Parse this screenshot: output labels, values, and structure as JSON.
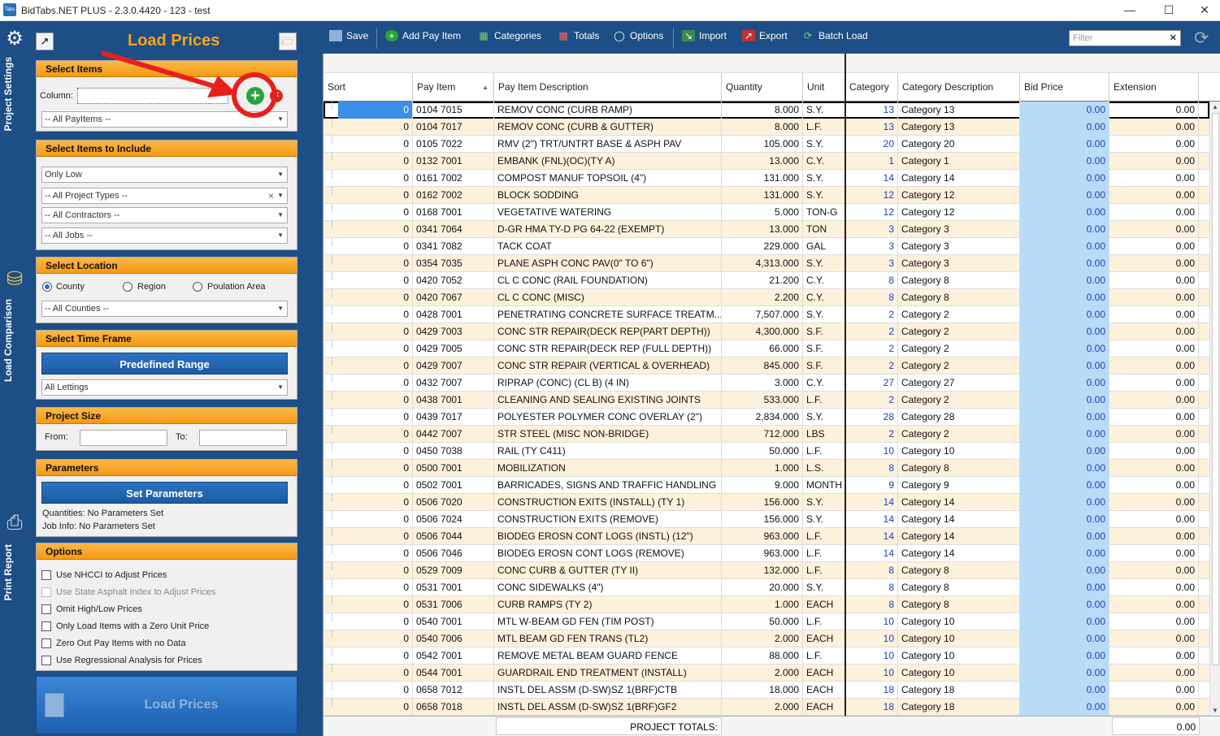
{
  "window": {
    "title": "BidTabs.NET PLUS - 2.3.0.4420 - 123 - test",
    "icon_text": "Tabs"
  },
  "vtabs": [
    {
      "label": "Project Settings",
      "icon": "gear-icon"
    },
    {
      "label": "Load Comparison",
      "icon": "database-icon"
    },
    {
      "label": "Print Report",
      "icon": "printer-icon"
    }
  ],
  "left": {
    "title": "Load Prices",
    "select_items": {
      "header": "Select Items",
      "column_label": "Column:",
      "payitems": "-- All PayItems --"
    },
    "include": {
      "header": "Select Items to Include",
      "price_mode": "Only Low",
      "project_types": "-- All Project Types --",
      "contractors": "-- All Contractors --",
      "jobs": "-- All Jobs --"
    },
    "location": {
      "header": "Select Location",
      "county": "County",
      "region": "Region",
      "population": "Poulation Area",
      "counties": "-- All Counties --"
    },
    "timeframe": {
      "header": "Select Time Frame",
      "button": "Predefined Range",
      "lettings": "All Lettings"
    },
    "size": {
      "header": "Project Size",
      "from": "From:",
      "to": "To:"
    },
    "params": {
      "header": "Parameters",
      "button": "Set Parameters",
      "qty": "Quantities: No Parameters Set",
      "job": "Job Info: No Parameters Set"
    },
    "options": {
      "header": "Options",
      "items": [
        "Use NHCCI to Adjust Prices",
        "Use State Asphalt Index to Adjust Prices",
        "Omit High/Low Prices",
        "Only Load Items with a Zero Unit  Price",
        "Zero Out Pay Items with no Data",
        "Use Regressional Analysis for Prices"
      ]
    },
    "load_button": "Load Prices"
  },
  "toolbar": {
    "save": "Save",
    "add": "Add Pay Item",
    "categories": "Categories",
    "totals": "Totals",
    "options": "Options",
    "import": "Import",
    "export": "Export",
    "batch": "Batch Load",
    "filter_placeholder": "Filter"
  },
  "grid": {
    "columns": [
      "Sort",
      "Pay Item",
      "Pay Item Description",
      "Quantity",
      "Unit",
      "Category",
      "Category Description",
      "Bid Price",
      "Extension"
    ],
    "rows": [
      [
        "0",
        "0104 7015",
        "REMOV CONC (CURB RAMP)",
        "8.000",
        "S.Y.",
        "13",
        "Category 13",
        "0.00",
        "0.00"
      ],
      [
        "0",
        "0104 7017",
        "REMOV CONC (CURB & GUTTER)",
        "8.000",
        "L.F.",
        "13",
        "Category 13",
        "0.00",
        "0.00"
      ],
      [
        "0",
        "0105 7022",
        "RMV (2\") TRT/UNTRT BASE & ASPH PAV",
        "105.000",
        "S.Y.",
        "20",
        "Category 20",
        "0.00",
        "0.00"
      ],
      [
        "0",
        "0132 7001",
        "EMBANK (FNL)(OC)(TY A)",
        "13.000",
        "C.Y.",
        "1",
        "Category 1",
        "0.00",
        "0.00"
      ],
      [
        "0",
        "0161 7002",
        "COMPOST MANUF TOPSOIL (4\")",
        "131.000",
        "S.Y.",
        "14",
        "Category 14",
        "0.00",
        "0.00"
      ],
      [
        "0",
        "0162 7002",
        "BLOCK SODDING",
        "131.000",
        "S.Y.",
        "12",
        "Category 12",
        "0.00",
        "0.00"
      ],
      [
        "0",
        "0168 7001",
        "VEGETATIVE WATERING",
        "5.000",
        "TON-G",
        "12",
        "Category 12",
        "0.00",
        "0.00"
      ],
      [
        "0",
        "0341 7064",
        "D-GR HMA TY-D PG 64-22 (EXEMPT)",
        "13.000",
        "TON",
        "3",
        "Category 3",
        "0.00",
        "0.00"
      ],
      [
        "0",
        "0341 7082",
        "TACK COAT",
        "229.000",
        "GAL",
        "3",
        "Category 3",
        "0.00",
        "0.00"
      ],
      [
        "0",
        "0354 7035",
        "PLANE ASPH CONC PAV(0\" TO 6\")",
        "4,313.000",
        "S.Y.",
        "3",
        "Category 3",
        "0.00",
        "0.00"
      ],
      [
        "0",
        "0420 7052",
        "CL C CONC (RAIL FOUNDATION)",
        "21.200",
        "C.Y.",
        "8",
        "Category 8",
        "0.00",
        "0.00"
      ],
      [
        "0",
        "0420 7067",
        "CL C CONC (MISC)",
        "2.200",
        "C.Y.",
        "8",
        "Category 8",
        "0.00",
        "0.00"
      ],
      [
        "0",
        "0428 7001",
        "PENETRATING CONCRETE SURFACE TREATM...",
        "7,507.000",
        "S.Y.",
        "2",
        "Category 2",
        "0.00",
        "0.00"
      ],
      [
        "0",
        "0429 7003",
        "CONC STR REPAIR(DECK REP(PART DEPTH))",
        "4,300.000",
        "S.F.",
        "2",
        "Category 2",
        "0.00",
        "0.00"
      ],
      [
        "0",
        "0429 7005",
        "CONC STR REPAIR(DECK REP (FULL DEPTH))",
        "66.000",
        "S.F.",
        "2",
        "Category 2",
        "0.00",
        "0.00"
      ],
      [
        "0",
        "0429 7007",
        "CONC STR REPAIR (VERTICAL & OVERHEAD)",
        "845.000",
        "S.F.",
        "2",
        "Category 2",
        "0.00",
        "0.00"
      ],
      [
        "0",
        "0432 7007",
        "RIPRAP (CONC) (CL B) (4 IN)",
        "3.000",
        "C.Y.",
        "27",
        "Category 27",
        "0.00",
        "0.00"
      ],
      [
        "0",
        "0438 7001",
        "CLEANING AND SEALING EXISTING JOINTS",
        "533.000",
        "L.F.",
        "2",
        "Category 2",
        "0.00",
        "0.00"
      ],
      [
        "0",
        "0439 7017",
        "POLYESTER POLYMER CONC OVERLAY (2\")",
        "2,834.000",
        "S.Y.",
        "28",
        "Category 28",
        "0.00",
        "0.00"
      ],
      [
        "0",
        "0442 7007",
        "STR STEEL (MISC NON-BRIDGE)",
        "712.000",
        "LBS",
        "2",
        "Category 2",
        "0.00",
        "0.00"
      ],
      [
        "0",
        "0450 7038",
        "RAIL (TY C411)",
        "50.000",
        "L.F.",
        "10",
        "Category 10",
        "0.00",
        "0.00"
      ],
      [
        "0",
        "0500 7001",
        "MOBILIZATION",
        "1.000",
        "L.S.",
        "8",
        "Category 8",
        "0.00",
        "0.00"
      ],
      [
        "0",
        "0502 7001",
        "BARRICADES, SIGNS AND TRAFFIC HANDLING",
        "9.000",
        "MONTH",
        "9",
        "Category 9",
        "0.00",
        "0.00"
      ],
      [
        "0",
        "0506 7020",
        "CONSTRUCTION EXITS (INSTALL) (TY 1)",
        "156.000",
        "S.Y.",
        "14",
        "Category 14",
        "0.00",
        "0.00"
      ],
      [
        "0",
        "0506 7024",
        "CONSTRUCTION EXITS (REMOVE)",
        "156.000",
        "S.Y.",
        "14",
        "Category 14",
        "0.00",
        "0.00"
      ],
      [
        "0",
        "0506 7044",
        "BIODEG EROSN CONT LOGS (INSTL) (12\")",
        "963.000",
        "L.F.",
        "14",
        "Category 14",
        "0.00",
        "0.00"
      ],
      [
        "0",
        "0506 7046",
        "BIODEG EROSN CONT LOGS (REMOVE)",
        "963.000",
        "L.F.",
        "14",
        "Category 14",
        "0.00",
        "0.00"
      ],
      [
        "0",
        "0529 7009",
        "CONC CURB & GUTTER (TY II)",
        "132.000",
        "L.F.",
        "8",
        "Category 8",
        "0.00",
        "0.00"
      ],
      [
        "0",
        "0531 7001",
        "CONC SIDEWALKS (4\")",
        "20.000",
        "S.Y.",
        "8",
        "Category 8",
        "0.00",
        "0.00"
      ],
      [
        "0",
        "0531 7006",
        "CURB RAMPS (TY 2)",
        "1.000",
        "EACH",
        "8",
        "Category 8",
        "0.00",
        "0.00"
      ],
      [
        "0",
        "0540 7001",
        "MTL W-BEAM GD FEN (TIM POST)",
        "50.000",
        "L.F.",
        "10",
        "Category 10",
        "0.00",
        "0.00"
      ],
      [
        "0",
        "0540 7006",
        "MTL BEAM GD FEN TRANS (TL2)",
        "2.000",
        "EACH",
        "10",
        "Category 10",
        "0.00",
        "0.00"
      ],
      [
        "0",
        "0542 7001",
        "REMOVE METAL BEAM GUARD FENCE",
        "88.000",
        "L.F.",
        "10",
        "Category 10",
        "0.00",
        "0.00"
      ],
      [
        "0",
        "0544 7001",
        "GUARDRAIL END TREATMENT (INSTALL)",
        "2.000",
        "EACH",
        "10",
        "Category 10",
        "0.00",
        "0.00"
      ],
      [
        "0",
        "0658 7012",
        "INSTL DEL ASSM (D-SW)SZ 1(BRF)CTB",
        "18.000",
        "EACH",
        "18",
        "Category 18",
        "0.00",
        "0.00"
      ],
      [
        "0",
        "0658 7018",
        "INSTL DEL ASSM (D-SW)SZ 1(BRF)GF2",
        "2.000",
        "EACH",
        "18",
        "Category 18",
        "0.00",
        "0.00"
      ]
    ],
    "totals_label": "PROJECT TOTALS:",
    "totals_value": "0.00"
  }
}
